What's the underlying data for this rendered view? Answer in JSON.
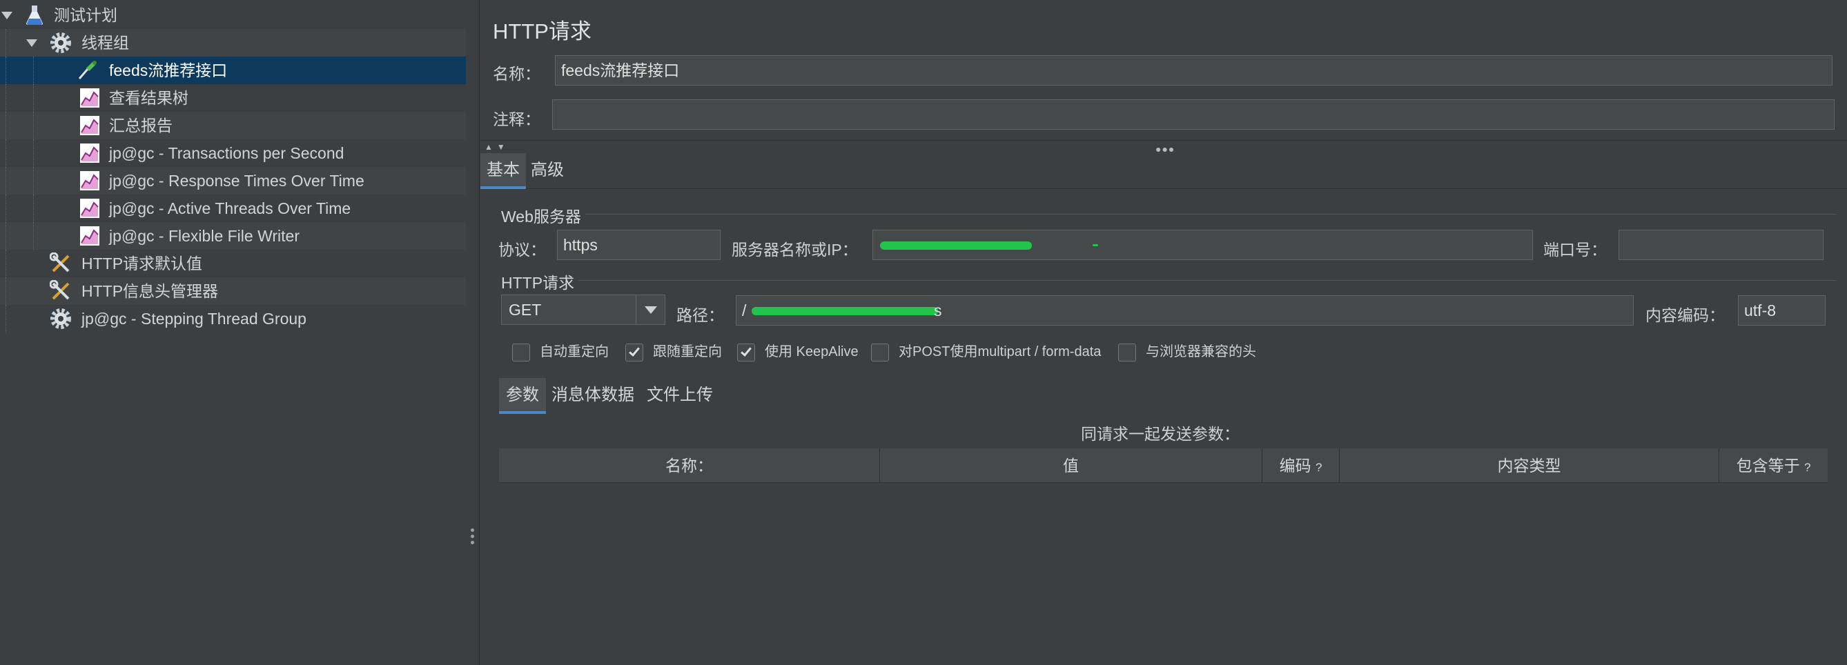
{
  "tree": {
    "items": [
      {
        "label": "测试计划",
        "icon": "flask-icon"
      },
      {
        "label": "线程组",
        "icon": "gear-icon"
      },
      {
        "label": "feeds流推荐接口",
        "icon": "pipette-icon"
      },
      {
        "label": "查看结果树",
        "icon": "chart-listener-icon"
      },
      {
        "label": "汇总报告",
        "icon": "chart-listener-icon"
      },
      {
        "label": "jp@gc - Transactions per Second",
        "icon": "chart-listener-icon"
      },
      {
        "label": "jp@gc - Response Times Over Time",
        "icon": "chart-listener-icon"
      },
      {
        "label": "jp@gc - Active Threads Over Time",
        "icon": "chart-listener-icon"
      },
      {
        "label": "jp@gc - Flexible File Writer",
        "icon": "chart-listener-icon"
      },
      {
        "label": "HTTP请求默认值",
        "icon": "wrench-icon"
      },
      {
        "label": "HTTP信息头管理器",
        "icon": "wrench-icon"
      },
      {
        "label": "jp@gc - Stepping Thread Group",
        "icon": "gear-icon"
      }
    ]
  },
  "panel": {
    "title": "HTTP请求",
    "name_label": "名称：",
    "name_value": "feeds流推荐接口",
    "comment_label": "注释：",
    "comment_value": "",
    "tabs": [
      "基本",
      "高级"
    ],
    "web_server": {
      "group_label": "Web服务器",
      "protocol_label": "协议：",
      "protocol_value": "https",
      "server_label": "服务器名称或IP：",
      "port_label": "端口号：",
      "port_value": ""
    },
    "http_request": {
      "group_label": "HTTP请求",
      "method": "GET",
      "path_label": "路径：",
      "path_prefix": "/",
      "path_suffix": "s",
      "encoding_label": "内容编码：",
      "encoding_value": "utf-8"
    },
    "checkboxes": [
      {
        "label": "自动重定向",
        "checked": false
      },
      {
        "label": "跟随重定向",
        "checked": true
      },
      {
        "label": "使用 KeepAlive",
        "checked": true
      },
      {
        "label": "对POST使用multipart / form-data",
        "checked": false
      },
      {
        "label": "与浏览器兼容的头",
        "checked": false
      }
    ],
    "subtabs": [
      "参数",
      "消息体数据",
      "文件上传"
    ],
    "params_caption": "同请求一起发送参数：",
    "columns": {
      "name": "名称：",
      "value": "值",
      "encode": "编码",
      "content_type": "内容类型",
      "include_equals": "包含等于",
      "help_mark": "?"
    }
  }
}
